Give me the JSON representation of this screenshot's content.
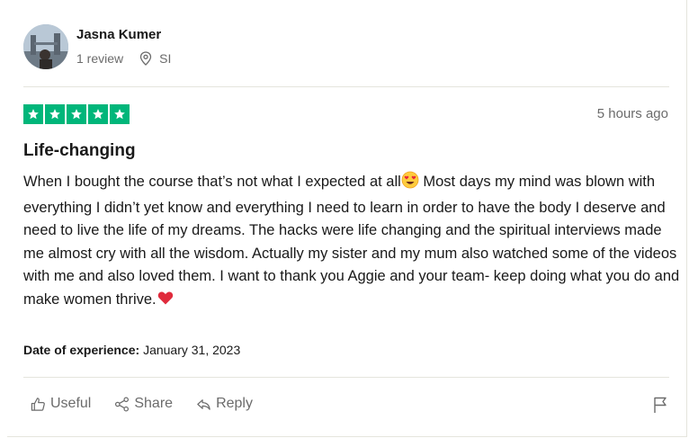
{
  "reviewer": {
    "name": "Jasna Kumer",
    "review_count": "1 review",
    "country": "SI",
    "avatar_icon": "avatar-photo"
  },
  "review": {
    "rating": 5,
    "rating_color": "#00b67a",
    "posted": "5 hours ago",
    "title": "Life-changing",
    "body_part1": "When I bought the course that’s not what I expected at all",
    "body_part2": " Most days my mind was blown with everything I didn’t yet know and everything I need to learn in order to have the body I deserve and need to live the life of my dreams. The hacks were life changing and the spiritual interviews made me almost cry with all the wisdom. Actually my sister and my mum also watched some of the videos with me and also loved them. I want to thank you Aggie and your team- keep doing what you do and make women thrive.",
    "emoji_1": "heart-eyes-emoji",
    "emoji_2": "red-heart-emoji",
    "experience_label": "Date of experience:",
    "experience_date": "January 31, 2023"
  },
  "actions": {
    "useful": "Useful",
    "share": "Share",
    "reply": "Reply",
    "flag_icon": "flag-icon"
  }
}
